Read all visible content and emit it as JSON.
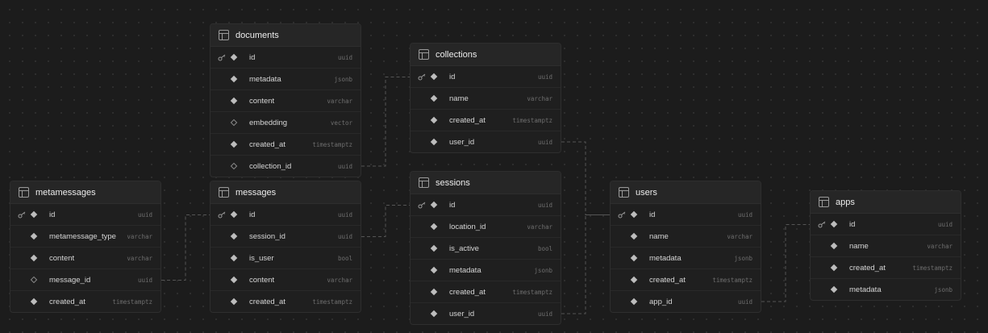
{
  "tables": [
    {
      "key": "documents",
      "name": "documents",
      "columns": [
        {
          "name": "id",
          "type": "uuid",
          "pk": true,
          "nullable": false
        },
        {
          "name": "metadata",
          "type": "jsonb",
          "pk": false,
          "nullable": false
        },
        {
          "name": "content",
          "type": "varchar",
          "pk": false,
          "nullable": false
        },
        {
          "name": "embedding",
          "type": "vector",
          "pk": false,
          "nullable": true
        },
        {
          "name": "created_at",
          "type": "timestamptz",
          "pk": false,
          "nullable": false
        },
        {
          "name": "collection_id",
          "type": "uuid",
          "pk": false,
          "nullable": true
        }
      ]
    },
    {
      "key": "collections",
      "name": "collections",
      "columns": [
        {
          "name": "id",
          "type": "uuid",
          "pk": true,
          "nullable": false
        },
        {
          "name": "name",
          "type": "varchar",
          "pk": false,
          "nullable": false
        },
        {
          "name": "created_at",
          "type": "timestamptz",
          "pk": false,
          "nullable": false
        },
        {
          "name": "user_id",
          "type": "uuid",
          "pk": false,
          "nullable": false
        }
      ]
    },
    {
      "key": "metamessages",
      "name": "metamessages",
      "columns": [
        {
          "name": "id",
          "type": "uuid",
          "pk": true,
          "nullable": false
        },
        {
          "name": "metamessage_type",
          "type": "varchar",
          "pk": false,
          "nullable": false
        },
        {
          "name": "content",
          "type": "varchar",
          "pk": false,
          "nullable": false
        },
        {
          "name": "message_id",
          "type": "uuid",
          "pk": false,
          "nullable": true
        },
        {
          "name": "created_at",
          "type": "timestamptz",
          "pk": false,
          "nullable": false
        }
      ]
    },
    {
      "key": "messages",
      "name": "messages",
      "columns": [
        {
          "name": "id",
          "type": "uuid",
          "pk": true,
          "nullable": false
        },
        {
          "name": "session_id",
          "type": "uuid",
          "pk": false,
          "nullable": false
        },
        {
          "name": "is_user",
          "type": "bool",
          "pk": false,
          "nullable": false
        },
        {
          "name": "content",
          "type": "varchar",
          "pk": false,
          "nullable": false
        },
        {
          "name": "created_at",
          "type": "timestamptz",
          "pk": false,
          "nullable": false
        }
      ]
    },
    {
      "key": "sessions",
      "name": "sessions",
      "columns": [
        {
          "name": "id",
          "type": "uuid",
          "pk": true,
          "nullable": false
        },
        {
          "name": "location_id",
          "type": "varchar",
          "pk": false,
          "nullable": false
        },
        {
          "name": "is_active",
          "type": "bool",
          "pk": false,
          "nullable": false
        },
        {
          "name": "metadata",
          "type": "jsonb",
          "pk": false,
          "nullable": false
        },
        {
          "name": "created_at",
          "type": "timestamptz",
          "pk": false,
          "nullable": false
        },
        {
          "name": "user_id",
          "type": "uuid",
          "pk": false,
          "nullable": false
        }
      ]
    },
    {
      "key": "users",
      "name": "users",
      "columns": [
        {
          "name": "id",
          "type": "uuid",
          "pk": true,
          "nullable": false
        },
        {
          "name": "name",
          "type": "varchar",
          "pk": false,
          "nullable": false
        },
        {
          "name": "metadata",
          "type": "jsonb",
          "pk": false,
          "nullable": false
        },
        {
          "name": "created_at",
          "type": "timestamptz",
          "pk": false,
          "nullable": false
        },
        {
          "name": "app_id",
          "type": "uuid",
          "pk": false,
          "nullable": false
        }
      ]
    },
    {
      "key": "apps",
      "name": "apps",
      "columns": [
        {
          "name": "id",
          "type": "uuid",
          "pk": true,
          "nullable": false
        },
        {
          "name": "name",
          "type": "varchar",
          "pk": false,
          "nullable": false
        },
        {
          "name": "created_at",
          "type": "timestamptz",
          "pk": false,
          "nullable": false
        },
        {
          "name": "metadata",
          "type": "jsonb",
          "pk": false,
          "nullable": false
        }
      ]
    }
  ],
  "relations": [
    {
      "from_table": "documents",
      "from_column": "collection_id",
      "to_table": "collections",
      "to_column": "id"
    },
    {
      "from_table": "collections",
      "from_column": "user_id",
      "to_table": "users",
      "to_column": "id"
    },
    {
      "from_table": "metamessages",
      "from_column": "message_id",
      "to_table": "messages",
      "to_column": "id"
    },
    {
      "from_table": "messages",
      "from_column": "session_id",
      "to_table": "sessions",
      "to_column": "id"
    },
    {
      "from_table": "sessions",
      "from_column": "user_id",
      "to_table": "users",
      "to_column": "id"
    },
    {
      "from_table": "users",
      "from_column": "app_id",
      "to_table": "apps",
      "to_column": "id"
    }
  ],
  "icons": {
    "table": "table-grid-icon",
    "primary_key": "key-icon",
    "not_null": "filled-diamond-icon",
    "nullable": "outline-diamond-icon"
  },
  "colors": {
    "canvas": "#1c1c1c",
    "grid_dot": "#333333",
    "card": "#1f1f1f",
    "card_header": "#262626",
    "border": "#2e2e2e",
    "text_primary": "#ededed",
    "text_type": "#6e6e6e",
    "connector": "#555555"
  }
}
